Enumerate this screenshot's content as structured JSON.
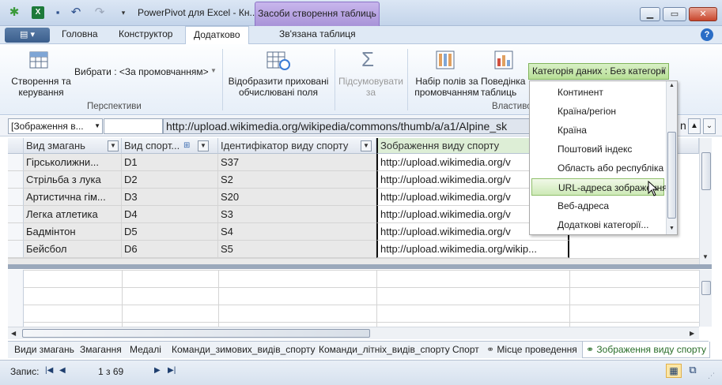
{
  "window": {
    "title": "PowerPivot для Excel - Кн...",
    "context_tab": "Засоби створення таблиць"
  },
  "ribbon": {
    "tabs": [
      "Головна",
      "Конструктор",
      "Додатково",
      "Зв'язана таблиця"
    ],
    "active_tab": "Додатково",
    "create_manage": "Створення та керування",
    "select_label": "Вибрати : <За промовчанням>",
    "perspectives_group": "Перспективи",
    "show_hidden": "Відобразити приховані обчислювані поля",
    "summarize": "Підсумовувати за",
    "default_fields": "Набір полів за промовчанням",
    "table_behavior": "Поведінка таблиць",
    "properties_group": "Властиво",
    "data_category_button": "Категорія даних : Без категорії"
  },
  "formula_bar": {
    "column_selector": "[Зображення в...",
    "formula": "http://upload.wikimedia.org/wikipedia/commons/thumb/a/a1/Alpine_sk",
    "trailing": "n"
  },
  "table": {
    "columns": [
      "Вид змагань",
      "Вид спорт...",
      "Ідентифікатор виду спорту",
      "Зображення виду спорту"
    ],
    "rows": [
      [
        "Гірськолижни...",
        "D1",
        "S37",
        "http://upload.wikimedia.org/v"
      ],
      [
        "Стрільба з лука",
        "D2",
        "S2",
        "http://upload.wikimedia.org/v"
      ],
      [
        "Артистична гім...",
        "D3",
        "S20",
        "http://upload.wikimedia.org/v"
      ],
      [
        "Легка атлетика",
        "D4",
        "S3",
        "http://upload.wikimedia.org/v"
      ],
      [
        "Бадмінтон",
        "D5",
        "S4",
        "http://upload.wikimedia.org/v"
      ],
      [
        "Бейсбол",
        "D6",
        "S5",
        "http://upload.wikimedia.org/wikip..."
      ]
    ]
  },
  "dropdown": {
    "items": [
      "Континент",
      "Країна/регіон",
      "Країна",
      "Поштовий індекс",
      "Область або республіка",
      "URL-адреса зображення",
      "Веб-адреса",
      "Додаткові категорії..."
    ],
    "highlighted": "URL-адреса зображення"
  },
  "sheet_tabs": [
    "Види змагань",
    "Змагання",
    "Медалі",
    "Команди_зимових_видів_спорту",
    "Команди_літніх_видів_спорту",
    "Спорт",
    "Місце проведення",
    "Зображення виду спорту"
  ],
  "active_sheet": "Зображення виду спорту",
  "status": {
    "record_label": "Запис:",
    "record_position": "1 з 69"
  },
  "colors": {
    "accent_green": "#b7df96",
    "context_purple": "#a893d8",
    "selected_column_header": "#ddeed6"
  }
}
